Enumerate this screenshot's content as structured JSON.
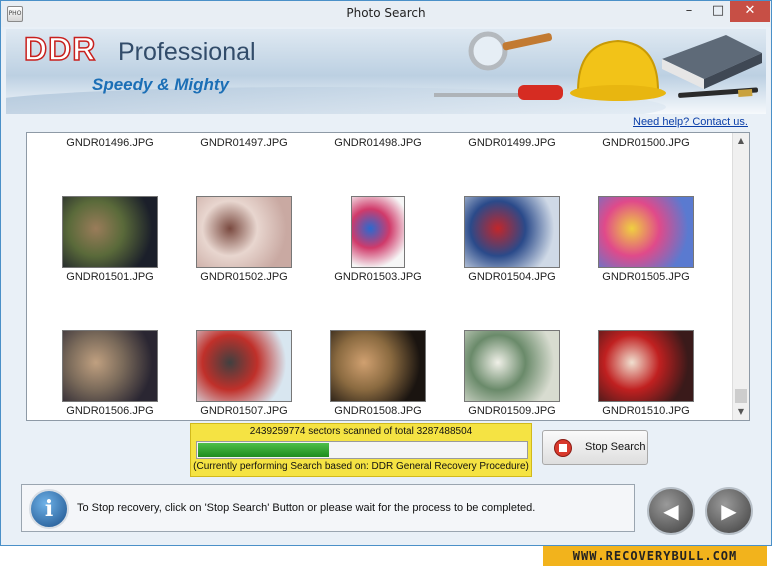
{
  "window": {
    "title": "Photo Search",
    "app_icon_text": "PHO",
    "minimize": "–",
    "maximize": "□",
    "close": "✕"
  },
  "banner": {
    "brand": "DDR",
    "product": "Professional",
    "tagline": "Speedy & Mighty"
  },
  "help_link": "Need help? Contact us.",
  "gallery": {
    "rows": [
      {
        "photos": [
          {
            "name": "GNDR01496.JPG",
            "thumb": false
          },
          {
            "name": "GNDR01497.JPG",
            "thumb": false
          },
          {
            "name": "GNDR01498.JPG",
            "thumb": false
          },
          {
            "name": "GNDR01499.JPG",
            "thumb": false
          },
          {
            "name": "GNDR01500.JPG",
            "thumb": false
          }
        ]
      },
      {
        "photos": [
          {
            "name": "GNDR01501.JPG",
            "thumb": true
          },
          {
            "name": "GNDR01502.JPG",
            "thumb": true
          },
          {
            "name": "GNDR01503.JPG",
            "thumb": true
          },
          {
            "name": "GNDR01504.JPG",
            "thumb": true
          },
          {
            "name": "GNDR01505.JPG",
            "thumb": true
          }
        ]
      },
      {
        "photos": [
          {
            "name": "GNDR01506.JPG",
            "thumb": true
          },
          {
            "name": "GNDR01507.JPG",
            "thumb": true
          },
          {
            "name": "GNDR01508.JPG",
            "thumb": true
          },
          {
            "name": "GNDR01509.JPG",
            "thumb": true
          },
          {
            "name": "GNDR01510.JPG",
            "thumb": true
          }
        ]
      }
    ]
  },
  "scan": {
    "sectors_text": "2439259774 sectors scanned of total 3287488504",
    "sectors_scanned": 2439259774,
    "sectors_total": 3287488504,
    "procedure_text": "(Currently performing Search based on:  DDR General Recovery Procedure)"
  },
  "stop_button": {
    "label": "Stop Search"
  },
  "status": {
    "message": "To Stop recovery, click on 'Stop Search' Button or please wait for the process to be completed."
  },
  "nav": {
    "back": "◀",
    "next": "▶"
  },
  "watermark": "WWW.RECOVERYBULL.COM",
  "colors": {
    "progress_fill": "#1e8c1e",
    "progress_panel": "#f5e343",
    "close_button": "#c74f45",
    "brand_red": "#c8201e",
    "link": "#0a3ea8"
  }
}
